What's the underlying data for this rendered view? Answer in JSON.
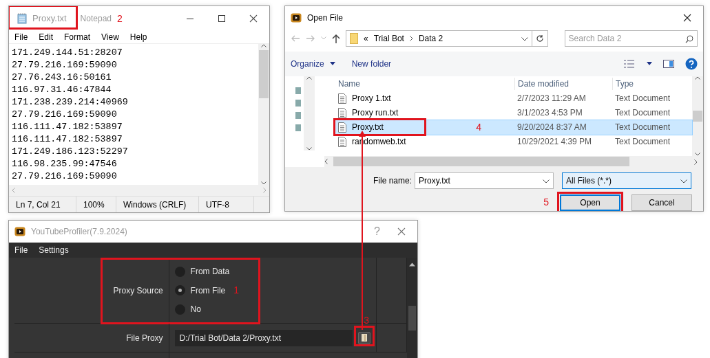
{
  "notepad": {
    "title": "Proxy.txt",
    "app_name": "Notepad",
    "callout": "2",
    "menu": [
      "File",
      "Edit",
      "Format",
      "View",
      "Help"
    ],
    "lines": [
      "171.249.144.51:28207",
      "27.79.216.169:59090",
      "27.76.243.16:50161",
      "116.97.31.46:47844",
      "171.238.239.214:40969",
      "27.79.216.169:59090",
      "116.111.47.182:53897",
      "116.111.47.182:53897",
      "171.249.186.123:52297",
      "116.98.235.99:47546",
      "27.79.216.169:59090"
    ],
    "status": [
      "Ln 7, Col 21",
      "100%",
      "Windows (CRLF)",
      "UTF-8"
    ]
  },
  "open_dialog": {
    "title": "Open File",
    "path_prefix": "«",
    "path": [
      "Trial Bot",
      "Data 2"
    ],
    "search": {
      "placeholder": "Search Data 2"
    },
    "toolbar": [
      "Organize",
      "New folder"
    ],
    "columns": [
      "Name",
      "Date modified",
      "Type"
    ],
    "rows": [
      {
        "name": "Proxy 1.txt",
        "date": "2/7/2023 11:29 AM",
        "type": "Text Document",
        "selected": false
      },
      {
        "name": "Proxy run.txt",
        "date": "3/1/2023 4:53 PM",
        "type": "Text Document",
        "selected": false
      },
      {
        "name": "Proxy.txt",
        "date": "9/20/2024 8:37 AM",
        "type": "Text Document",
        "selected": true,
        "callout": "4"
      },
      {
        "name": "randomweb.txt",
        "date": "10/29/2021 4:39 PM",
        "type": "Text Document",
        "selected": false
      }
    ],
    "file_name_label": "File name:",
    "file_name": "Proxy.txt",
    "filter": "All Files (*.*)",
    "buttons": [
      {
        "label": "Open",
        "kind": "default",
        "callout": "5"
      },
      {
        "label": "Cancel",
        "kind": "normal"
      }
    ]
  },
  "app": {
    "title": "YouTubeProfiler(7.9.2024)",
    "help": "?",
    "menu": [
      "File",
      "Settings"
    ],
    "fields": [
      {
        "kind": "radio",
        "label": "Proxy Source",
        "callout": "1",
        "options": [
          {
            "label": "From Data",
            "selected": false
          },
          {
            "label": "From File",
            "selected": true
          },
          {
            "label": "No",
            "selected": false
          }
        ]
      },
      {
        "kind": "path",
        "label": "File Proxy",
        "value": "D:/Trial Bot/Data 2/Proxy.txt",
        "callout": "3"
      }
    ]
  }
}
